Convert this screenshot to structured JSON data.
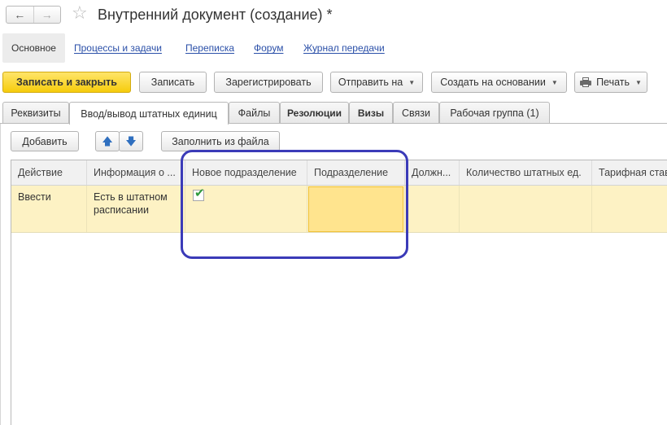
{
  "window": {
    "title": "Внутренний документ (создание) *",
    "back_icon": "←",
    "forward_icon": "→",
    "favorite_icon": "☆"
  },
  "form_nav": {
    "items": [
      {
        "label": "Основное",
        "active": true
      },
      {
        "label": "Процессы и задачи"
      },
      {
        "label": "Переписка"
      },
      {
        "label": "Форум"
      },
      {
        "label": "Журнал передачи"
      }
    ]
  },
  "commands": {
    "save_close": "Записать и закрыть",
    "save": "Записать",
    "register": "Зарегистрировать",
    "send_to": "Отправить на",
    "create_based": "Создать на основании",
    "print": "Печать"
  },
  "tabs": [
    {
      "label": "Реквизиты"
    },
    {
      "label": "Ввод/вывод штатных единиц",
      "active": true
    },
    {
      "label": "Файлы"
    },
    {
      "label": "Резолюции"
    },
    {
      "label": "Визы"
    },
    {
      "label": "Связи"
    },
    {
      "label": "Рабочая группа (1)"
    }
  ],
  "table_toolbar": {
    "add": "Добавить",
    "fill_from_file": "Заполнить из файла",
    "up_icon": "🡅",
    "down_icon": "🡇"
  },
  "table": {
    "columns": [
      "Действие",
      "Информация о ...",
      "Новое подразделение",
      "Подразделение",
      "Должн...",
      "Количество штатных ед.",
      "Тарифная ставка"
    ],
    "rows": [
      {
        "action": "Ввести",
        "info": "Есть в штатном расписании",
        "new_department": true,
        "department": "",
        "position": "",
        "staff_units": "",
        "tariff_rate": ""
      }
    ]
  },
  "colors": {
    "primary_button": "#f6cc0c",
    "link": "#2a4fa8",
    "selected_row": "#fdf2c4",
    "focused_cell": "#ffe48e",
    "highlight_frame": "#3b3bb8",
    "checkmark": "#2e9a3c"
  }
}
